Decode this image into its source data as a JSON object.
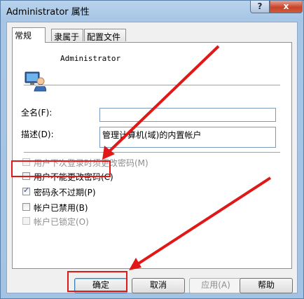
{
  "window": {
    "title": "Administrator 属性",
    "help_glyph": "?",
    "close_glyph": "x"
  },
  "tabs": [
    {
      "label": "常规",
      "active": true
    },
    {
      "label": "隶属于",
      "active": false
    },
    {
      "label": "配置文件",
      "active": false
    }
  ],
  "user": {
    "name": "Administrator",
    "icon": "user-icon"
  },
  "fields": {
    "fullname_label": "全名(F):",
    "fullname_value": "",
    "description_label": "描述(D):",
    "description_value": "管理计算机(域)的内置帐户"
  },
  "options": [
    {
      "label": "用户下次登录时须更改密码(M)",
      "checked": false,
      "disabled": true
    },
    {
      "label": "用户不能更改密码(C)",
      "checked": false,
      "disabled": false
    },
    {
      "label": "密码永不过期(P)",
      "checked": true,
      "disabled": false
    },
    {
      "label": "帐户已禁用(B)",
      "checked": false,
      "disabled": false
    },
    {
      "label": "帐户已锁定(O)",
      "checked": false,
      "disabled": true
    }
  ],
  "buttons": {
    "ok": "确定",
    "cancel": "取消",
    "apply": "应用(A)",
    "help": "帮助"
  },
  "colors": {
    "annotation": "#e01818",
    "title_bar": "#b9d3ec"
  }
}
